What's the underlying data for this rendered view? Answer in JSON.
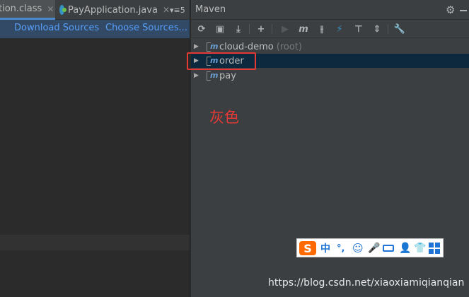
{
  "editor": {
    "tabs": [
      {
        "label": "tion.class",
        "close": "✕"
      },
      {
        "label": "PayApplication.java",
        "close": "✕"
      }
    ],
    "tab_overflow": "▾≡5",
    "banner": {
      "download_sources": "Download Sources",
      "choose_sources": "Choose Sources..."
    }
  },
  "maven": {
    "title": "Maven",
    "settings_icon": "⚙",
    "toolbar": {
      "reload": "⟳",
      "generate": "▣",
      "download": "⤓",
      "add": "+",
      "run": "▶",
      "execute_goal": "m",
      "toggle_offline": "⫲",
      "skip_tests": "⚡",
      "show_dependencies": "⊤",
      "collapse_all": "⇕",
      "settings": "🔧"
    },
    "tree": [
      {
        "label": "cloud-demo",
        "suffix": "(root)",
        "icon": "m"
      },
      {
        "label": "order",
        "suffix": "",
        "icon": "m"
      },
      {
        "label": "pay",
        "suffix": "",
        "icon": "m"
      }
    ]
  },
  "annotation": "灰色",
  "ime": {
    "logo": "S",
    "lang": "中",
    "punct": "°,",
    "emoji": "☺",
    "voice": "🎤",
    "user": "👤",
    "skin": "👕"
  },
  "watermark": "https://blog.csdn.net/xiaoxiamiqianqian",
  "colors": {
    "accent": "#4a88c7",
    "link": "#589df6",
    "selection": "#0d293e",
    "annotation": "#e53935"
  }
}
